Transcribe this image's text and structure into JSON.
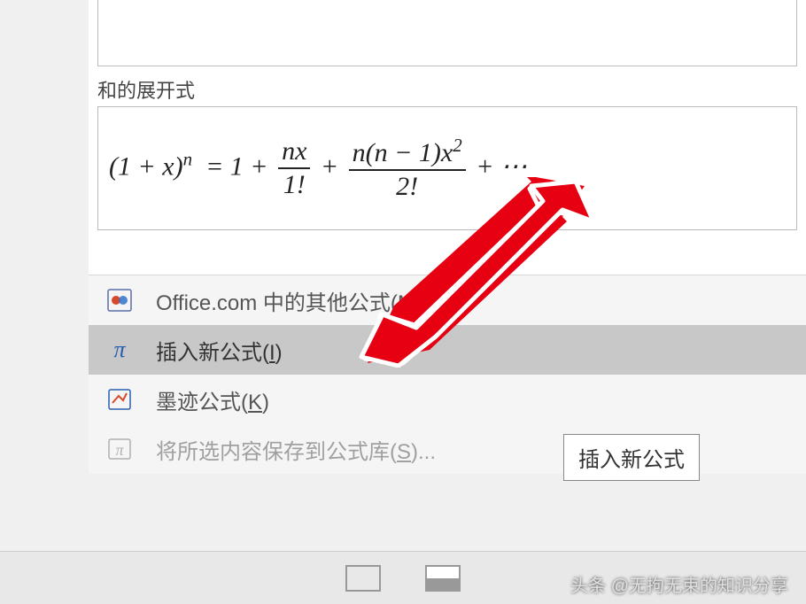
{
  "preview": {
    "label": "和的展开式",
    "equation_text": "(1 + x)^n = 1 + nx/1! + n(n-1)x²/2! + ⋯"
  },
  "menu": {
    "items": [
      {
        "icon": "office-icon",
        "label": "Office.com 中的其他公式(",
        "hotkey": "M",
        "suffix": ")"
      },
      {
        "icon": "pi-icon",
        "label": "插入新公式(",
        "hotkey": "I",
        "suffix": ")"
      },
      {
        "icon": "ink-icon",
        "label": "墨迹公式(",
        "hotkey": "K",
        "suffix": ")"
      },
      {
        "icon": "save-icon",
        "label": "将所选内容保存到公式库(",
        "hotkey": "S",
        "suffix": ")..."
      }
    ]
  },
  "tooltip": {
    "text": "插入新公式"
  },
  "watermark": {
    "text": "头条 @无拘无束的知识分享"
  }
}
